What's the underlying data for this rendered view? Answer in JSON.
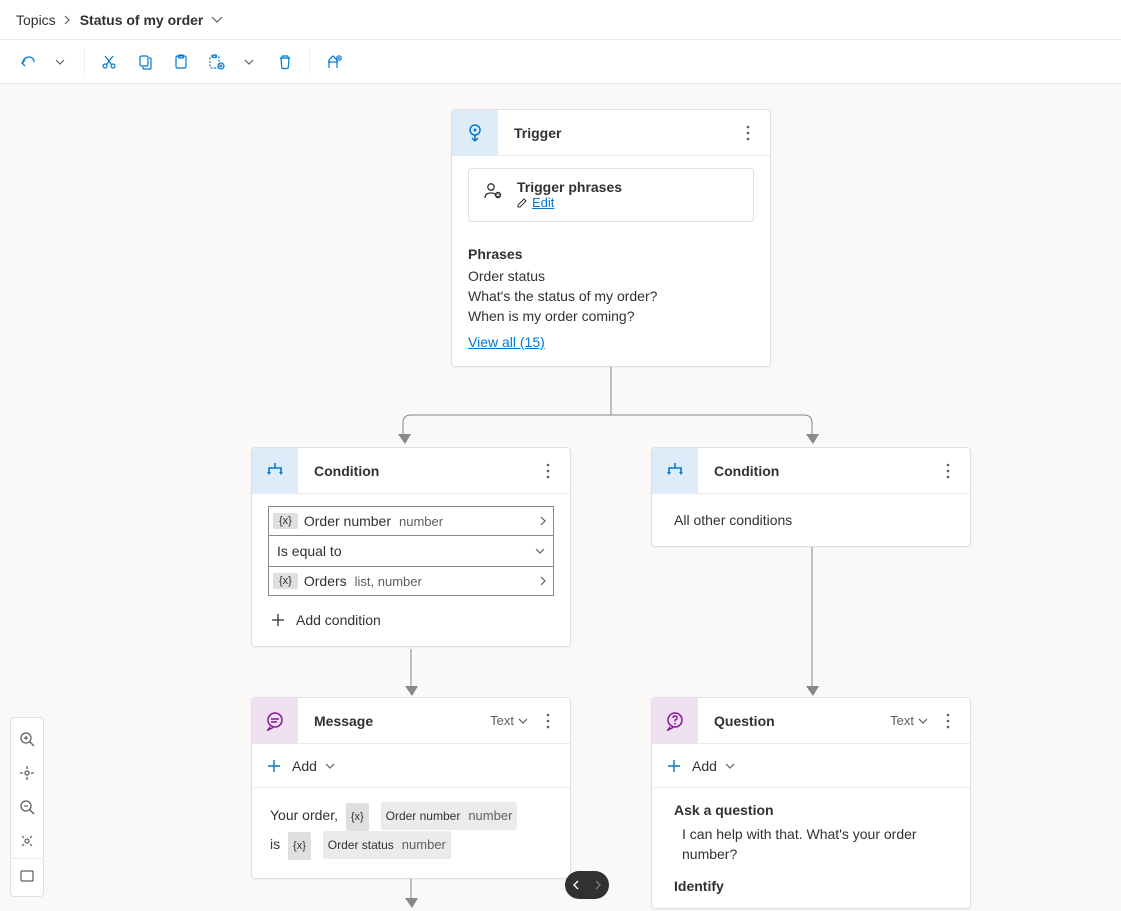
{
  "breadcrumb": {
    "root": "Topics",
    "current": "Status of my order"
  },
  "trigger": {
    "title": "Trigger",
    "phrases_card": {
      "label": "Trigger phrases",
      "edit": "Edit"
    },
    "phrases_header": "Phrases",
    "phrases": [
      "Order status",
      "What's the status of my order?",
      "When is my order coming?"
    ],
    "view_all": "View all (15)"
  },
  "condition1": {
    "title": "Condition",
    "var1_name": "Order number",
    "var1_type": "number",
    "operator": "Is equal to",
    "var2_name": "Orders",
    "var2_type": "list, number",
    "add_label": "Add condition"
  },
  "condition2": {
    "title": "Condition",
    "other": "All other conditions"
  },
  "message": {
    "title": "Message",
    "badge": "Text",
    "add": "Add",
    "t1": "Your order,",
    "v1": "Order number",
    "v1t": "number",
    "t2": "is",
    "v2": "Order status",
    "v2t": "number"
  },
  "question": {
    "title": "Question",
    "badge": "Text",
    "add": "Add",
    "ask_label": "Ask a question",
    "ask_text": "I can help with that. What's your order number?",
    "identify_label": "Identify"
  }
}
